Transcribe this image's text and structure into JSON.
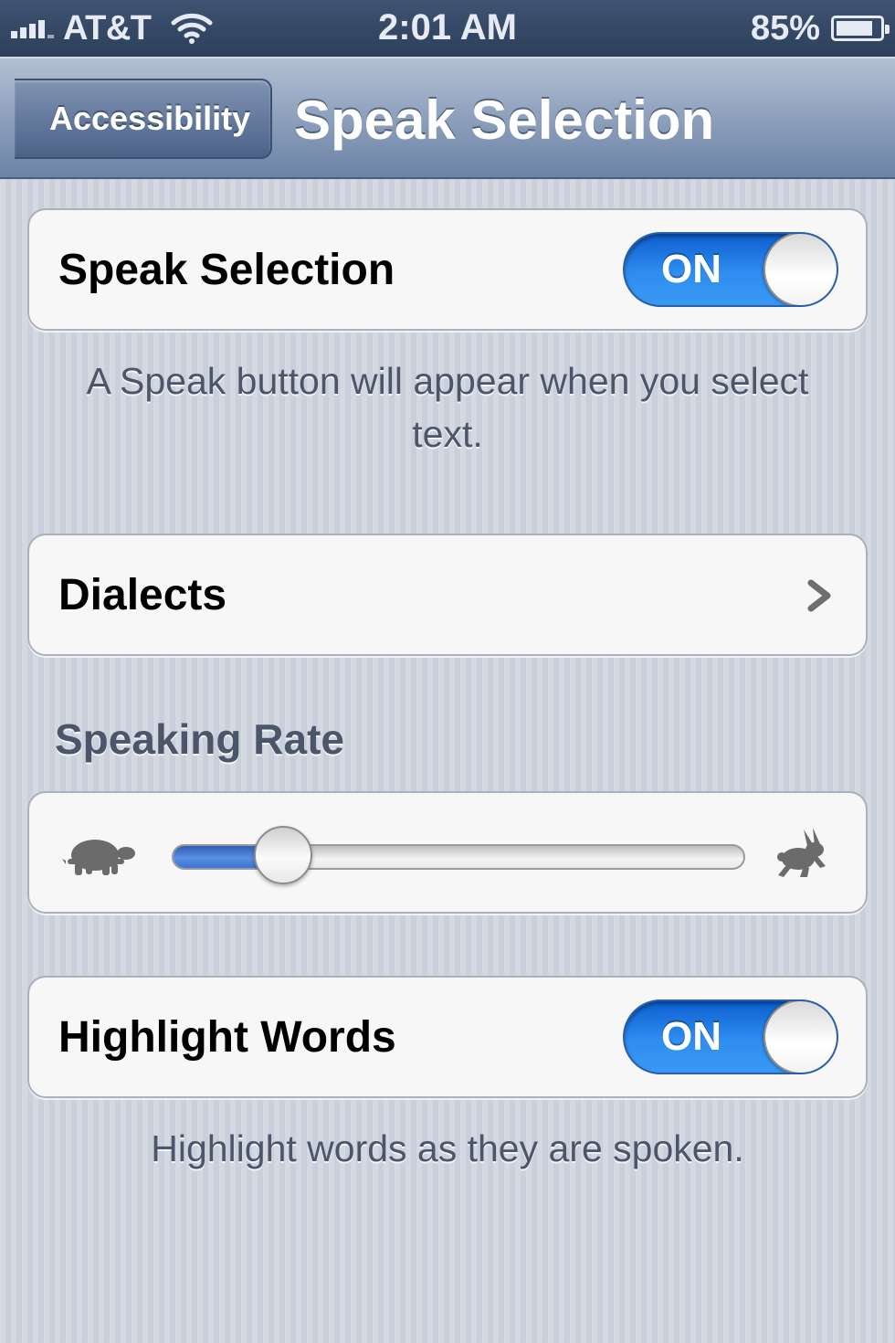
{
  "status_bar": {
    "carrier": "AT&T",
    "time": "2:01 AM",
    "battery_percent_label": "85%",
    "battery_level": 0.85,
    "signal_bars": 4
  },
  "nav": {
    "back_label": "Accessibility",
    "title": "Speak Selection"
  },
  "speak_selection": {
    "label": "Speak Selection",
    "toggle_label": "ON",
    "footer": "A Speak button will appear when you select text."
  },
  "dialects": {
    "label": "Dialects"
  },
  "speaking_rate": {
    "header": "Speaking Rate",
    "value": 0.16
  },
  "highlight_words": {
    "label": "Highlight Words",
    "toggle_label": "ON",
    "footer": "Highlight words as they are spoken."
  },
  "colors": {
    "accent": "#2f8df0",
    "nav_bar": "#8da0bc",
    "status_bar": "#2c3f5b",
    "background": "#c9cfdb"
  },
  "icons": {
    "slow": "turtle-icon",
    "fast": "rabbit-icon",
    "disclosure": "chevron-right-icon",
    "wifi": "wifi-icon",
    "battery": "battery-icon",
    "signal": "signal-icon"
  }
}
